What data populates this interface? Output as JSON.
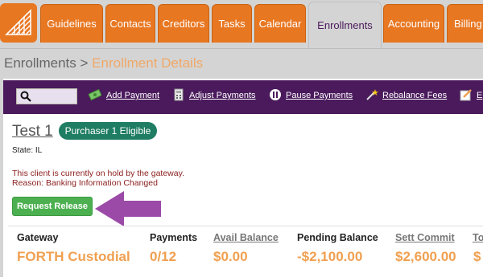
{
  "nav": {
    "tabs": [
      {
        "label": "Guidelines"
      },
      {
        "label": "Contacts"
      },
      {
        "label": "Creditors"
      },
      {
        "label": "Tasks"
      },
      {
        "label": "Calendar"
      },
      {
        "label": "Enrollments"
      },
      {
        "label": "Accounting"
      },
      {
        "label": "Billing"
      }
    ],
    "active_tab": "Enrollments",
    "accent": "#e87722"
  },
  "breadcrumb": {
    "parent": "Enrollments",
    "separator": ">",
    "current": "Enrollment Details"
  },
  "toolbar": {
    "search_value": "",
    "actions": [
      {
        "label": "Add Payment",
        "icon": "money-icon"
      },
      {
        "label": "Adjust Payments",
        "icon": "calculator-icon"
      },
      {
        "label": "Pause Payments",
        "icon": "pause-icon"
      },
      {
        "label": "Rebalance Fees",
        "icon": "magic-wand-icon"
      },
      {
        "label": "E",
        "icon": "edit-icon"
      }
    ]
  },
  "client": {
    "name": "Test 1",
    "badge": "Purchaser 1 Eligible",
    "state": "State: IL",
    "hold_message": "This client is currently on hold by the gateway.",
    "hold_reason": "Reason: Banking Information Changed",
    "request_release_label": "Request Release"
  },
  "summary": {
    "headers": [
      "Gateway",
      "Payments",
      "Avail Balance",
      "Pending Balance",
      "Sett Commit",
      "To"
    ],
    "values": [
      "FORTH Custodial",
      "0/12",
      "$0.00",
      "-$2,100.00",
      "$2,600.00",
      "$"
    ]
  }
}
